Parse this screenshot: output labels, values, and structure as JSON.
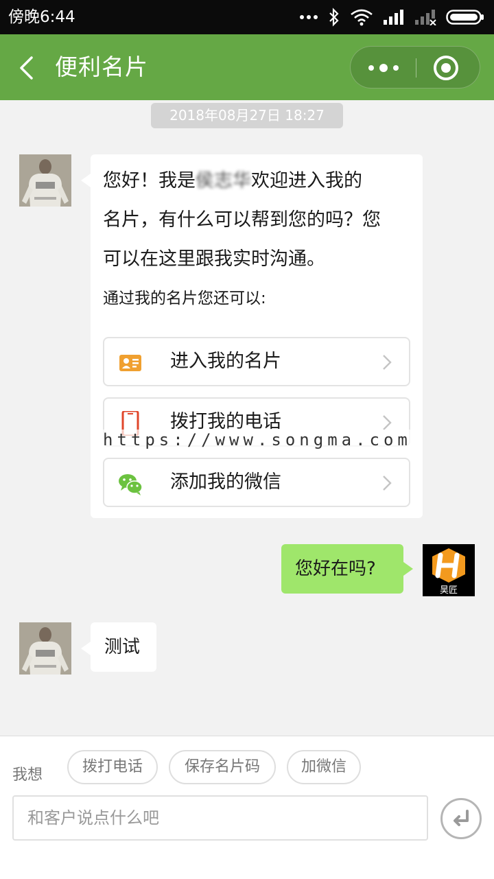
{
  "status_bar": {
    "time": "傍晚6:44"
  },
  "header": {
    "title": "便利名片"
  },
  "chat": {
    "timestamp": "2018年08月27日 18:27",
    "welcome": {
      "greeting": "您好！我是",
      "name": "侯志华",
      "line1_rest": "欢迎进入我的",
      "line2": "名片，有什么可以帮到您的吗？您",
      "line3": "可以在这里跟我实时沟通。",
      "sub": "通过我的名片您还可以:",
      "actions": [
        {
          "label": "进入我的名片",
          "icon": "id-card-icon",
          "color": "#f0a030"
        },
        {
          "label": "拨打我的电话",
          "icon": "phone-icon",
          "color": "#e0462a"
        },
        {
          "label": "添加我的微信",
          "icon": "wechat-icon",
          "color": "#6cc240"
        }
      ]
    },
    "user_message": "您好在吗?",
    "agent_reply": "测试",
    "watermark": "https://www.songma.com",
    "user_logo_text": "昊匠"
  },
  "quick_replies": {
    "label": "我想",
    "chips": [
      "拨打电话",
      "保存名片码",
      "加微信"
    ]
  },
  "input": {
    "placeholder": "和客户说点什么吧"
  },
  "colors": {
    "header": "#65a845",
    "user_bubble": "#9fe66b"
  }
}
